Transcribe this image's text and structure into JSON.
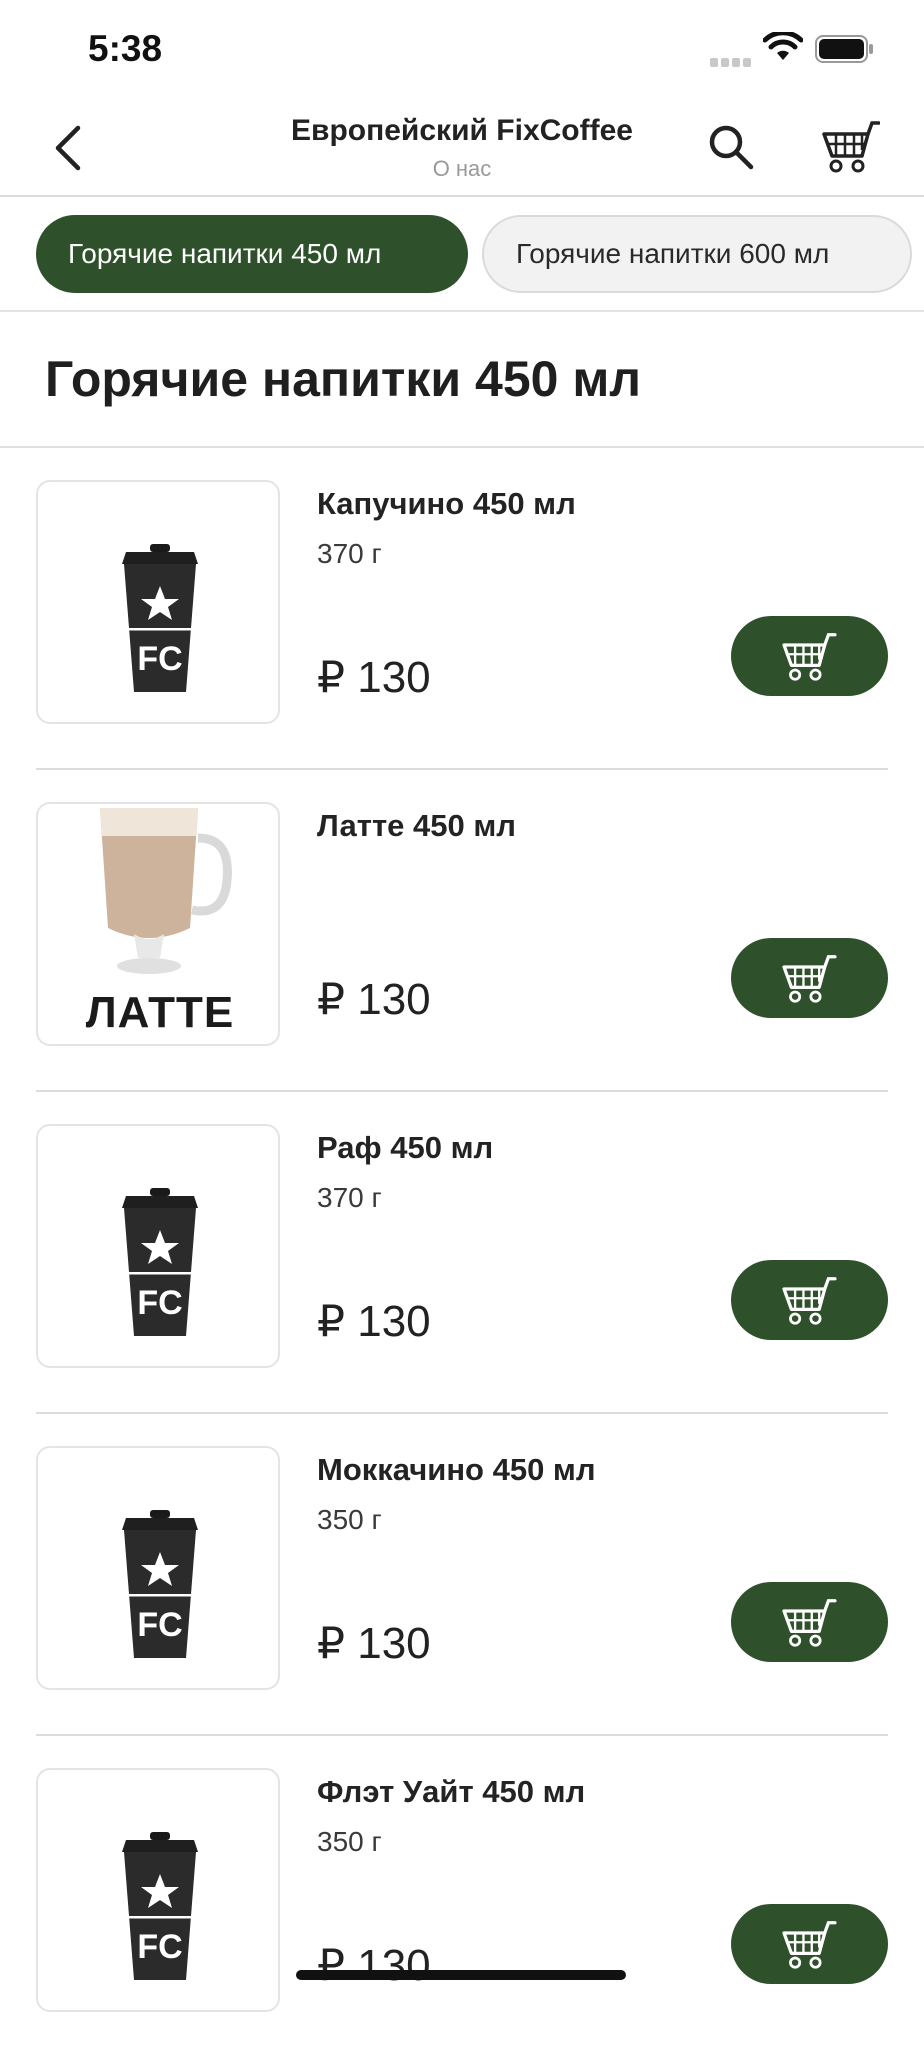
{
  "status": {
    "time": "5:38"
  },
  "nav": {
    "title": "Европейский FixCoffee",
    "subtitle": "О нас"
  },
  "tabs": [
    {
      "label": "Горячие напитки 450 мл",
      "active": true
    },
    {
      "label": "Горячие напитки 600 мл",
      "active": false
    }
  ],
  "section": {
    "title": "Горячие напитки 450 мл"
  },
  "products": [
    {
      "name": "Капучино 450 мл",
      "weight": "370 г",
      "price": "₽ 130",
      "image": "coffee-cup"
    },
    {
      "name": "Латте 450 мл",
      "weight": "",
      "price": "₽ 130",
      "image": "latte-glass",
      "image_caption": "ЛАТТЕ"
    },
    {
      "name": "Раф 450 мл",
      "weight": "370 г",
      "price": "₽ 130",
      "image": "coffee-cup"
    },
    {
      "name": "Моккачино 450 мл",
      "weight": "350 г",
      "price": "₽ 130",
      "image": "coffee-cup"
    },
    {
      "name": "Флэт Уайт 450 мл",
      "weight": "350 г",
      "price": "₽ 130",
      "image": "coffee-cup"
    }
  ],
  "cup_logo": {
    "brand": "FC"
  },
  "colors": {
    "accent": "#2e512b",
    "divider": "#dcdcdc",
    "muted": "#9a9a9a"
  }
}
